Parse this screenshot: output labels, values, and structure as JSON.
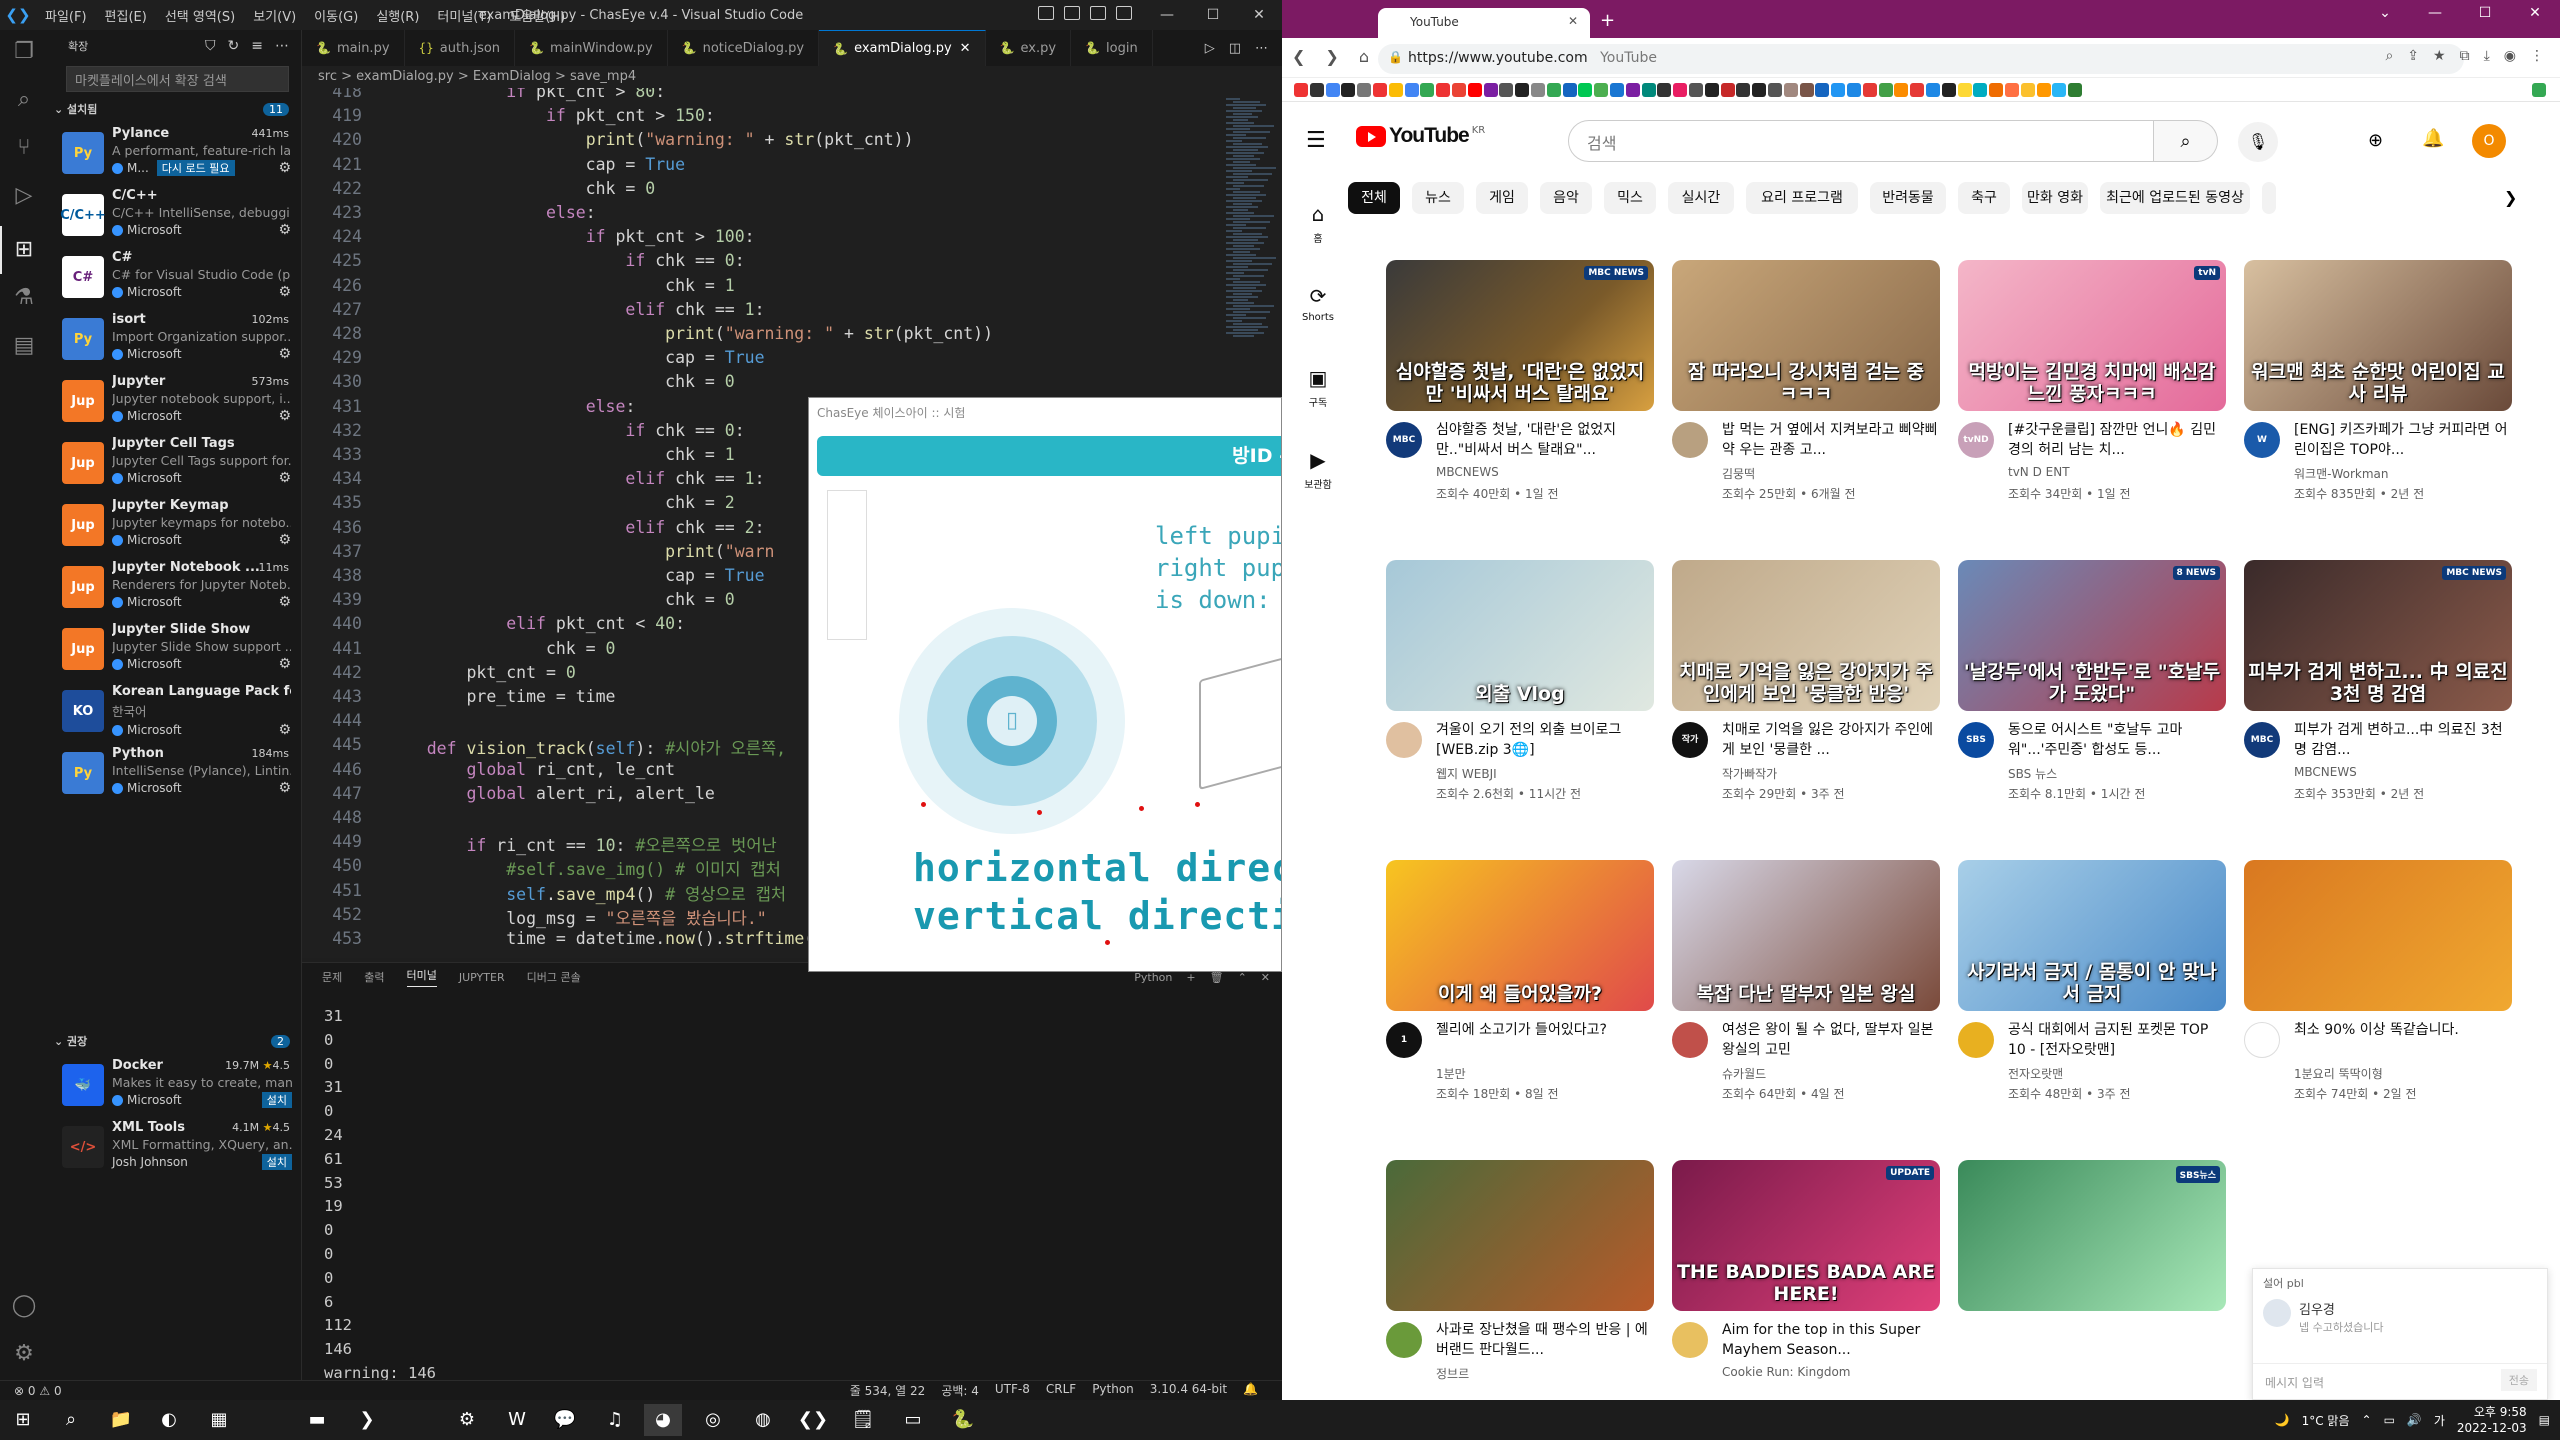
{
  "vscode": {
    "window_title": "examDialog.py - ChasEye v.4 - Visual Studio Code",
    "menu": [
      "파일(F)",
      "편집(E)",
      "선택 영역(S)",
      "보기(V)",
      "이동(G)",
      "실행(R)",
      "터미널(T)",
      "도움말(H)"
    ],
    "sidebar": {
      "header": "확장",
      "search_placeholder": "마켓플레이스에서 확장 검색",
      "installed_label": "설치됨",
      "installed_count": "11",
      "recommended_label": "권장",
      "recommended_count": "2",
      "extensions": [
        {
          "name": "Pylance",
          "time": "441ms",
          "desc": "A performant, feature-rich la...",
          "publisher": "M...",
          "badge": "다시 로드 필요"
        },
        {
          "name": "C/C++",
          "time": "",
          "desc": "C/C++ IntelliSense, debuggi...",
          "publisher": "Microsoft",
          "badge": ""
        },
        {
          "name": "C#",
          "time": "",
          "desc": "C# for Visual Studio Code (p...",
          "publisher": "Microsoft",
          "badge": ""
        },
        {
          "name": "isort",
          "time": "102ms",
          "desc": "Import Organization suppor...",
          "publisher": "Microsoft",
          "badge": ""
        },
        {
          "name": "Jupyter",
          "time": "573ms",
          "desc": "Jupyter notebook support, i...",
          "publisher": "Microsoft",
          "badge": ""
        },
        {
          "name": "Jupyter Cell Tags",
          "time": "",
          "desc": "Jupyter Cell Tags support for...",
          "publisher": "Microsoft",
          "badge": ""
        },
        {
          "name": "Jupyter Keymap",
          "time": "",
          "desc": "Jupyter keymaps for notebo...",
          "publisher": "Microsoft",
          "badge": ""
        },
        {
          "name": "Jupyter Notebook ...",
          "time": "11ms",
          "desc": "Renderers for Jupyter Noteb...",
          "publisher": "Microsoft",
          "badge": ""
        },
        {
          "name": "Jupyter Slide Show",
          "time": "",
          "desc": "Jupyter Slide Show support ...",
          "publisher": "Microsoft",
          "badge": ""
        },
        {
          "name": "Korean Language Pack for...",
          "time": "",
          "desc": "한국어",
          "publisher": "Microsoft",
          "badge": ""
        },
        {
          "name": "Python",
          "time": "184ms",
          "desc": "IntelliSense (Pylance), Lintin...",
          "publisher": "Microsoft",
          "badge": ""
        }
      ],
      "recommended": [
        {
          "name": "Docker",
          "downloads": "19.7M",
          "rating": "4.5",
          "desc": "Makes it easy to create, man...",
          "publisher": "Microsoft",
          "install": "설치"
        },
        {
          "name": "XML Tools",
          "downloads": "4.1M",
          "rating": "4.5",
          "desc": "XML Formatting, XQuery, an...",
          "publisher": "Josh Johnson",
          "install": "설치"
        }
      ]
    },
    "tabs": [
      "main.py",
      "auth.json",
      "mainWindow.py",
      "noticeDialog.py",
      "examDialog.py",
      "ex.py",
      "login"
    ],
    "breadcrumb": "src > examDialog.py > ExamDialog > save_mp4",
    "code_lines": [
      {
        "n": "418",
        "t": "            if pkt_cnt > 80:"
      },
      {
        "n": "419",
        "t": "                if pkt_cnt > 150:"
      },
      {
        "n": "420",
        "t": "                    print(\"warning: \" + str(pkt_cnt))"
      },
      {
        "n": "421",
        "t": "                    cap = True"
      },
      {
        "n": "422",
        "t": "                    chk = 0"
      },
      {
        "n": "423",
        "t": "                else:"
      },
      {
        "n": "424",
        "t": "                    if pkt_cnt > 100:"
      },
      {
        "n": "425",
        "t": "                        if chk == 0:"
      },
      {
        "n": "426",
        "t": "                            chk = 1"
      },
      {
        "n": "427",
        "t": "                        elif chk == 1:"
      },
      {
        "n": "428",
        "t": "                            print(\"warning: \" + str(pkt_cnt))"
      },
      {
        "n": "429",
        "t": "                            cap = True"
      },
      {
        "n": "430",
        "t": "                            chk = 0"
      },
      {
        "n": "431",
        "t": "                    else:"
      },
      {
        "n": "432",
        "t": "                        if chk == 0:"
      },
      {
        "n": "433",
        "t": "                            chk = 1"
      },
      {
        "n": "434",
        "t": "                        elif chk == 1:"
      },
      {
        "n": "435",
        "t": "                            chk = 2"
      },
      {
        "n": "436",
        "t": "                        elif chk == 2:"
      },
      {
        "n": "437",
        "t": "                            print(\"warn"
      },
      {
        "n": "438",
        "t": "                            cap = True"
      },
      {
        "n": "439",
        "t": "                            chk = 0"
      },
      {
        "n": "440",
        "t": "            elif pkt_cnt < 40:"
      },
      {
        "n": "441",
        "t": "                chk = 0"
      },
      {
        "n": "442",
        "t": "        pkt_cnt = 0"
      },
      {
        "n": "443",
        "t": "        pre_time = time"
      },
      {
        "n": "444",
        "t": ""
      },
      {
        "n": "445",
        "t": "    def vision_track(self): #시야가 오른쪽,"
      },
      {
        "n": "446",
        "t": "        global ri_cnt, le_cnt"
      },
      {
        "n": "447",
        "t": "        global alert_ri, alert_le"
      },
      {
        "n": "448",
        "t": ""
      },
      {
        "n": "449",
        "t": "        if ri_cnt == 10: #오른쪽으로 벗어난"
      },
      {
        "n": "450",
        "t": "            #self.save_img() # 이미지 캡처"
      },
      {
        "n": "451",
        "t": "            self.save_mp4() # 영상으로 캡처"
      },
      {
        "n": "452",
        "t": "            log_msg = \"오른쪽을 봤습니다.\""
      },
      {
        "n": "453",
        "t": "            time = datetime.now().strftime("
      }
    ],
    "panel_tabs": [
      "문제",
      "출력",
      "터미널",
      "JUPYTER",
      "디버그 콘솔"
    ],
    "panel_active": "터미널",
    "panel_shell": "Python",
    "terminal_lines": [
      "31",
      "0",
      "0",
      "31",
      "0",
      "24",
      "61",
      "53",
      "19",
      "0",
      "0",
      "0",
      "6",
      "112",
      "146",
      "warning: 146"
    ],
    "status": {
      "errors": "0",
      "warnings": "0",
      "position": "줄 534, 열 22",
      "spaces": "공백: 4",
      "encoding": "UTF-8",
      "eol": "CRLF",
      "language": "Python",
      "interpreter": "3.10.4 64-bit"
    }
  },
  "dialog": {
    "title": "ChasEye 체이스아이 :: 시험",
    "banner": "방ID -",
    "pupil_lines": [
      "left pupil:",
      "right pupi",
      "is down: "
    ],
    "direction_h": "horizontal direction",
    "direction_v": "vertical direction"
  },
  "chrome": {
    "tab_title": "YouTube",
    "url": "https://www.youtube.com",
    "url_hint": "YouTube"
  },
  "youtube": {
    "logo": "YouTube",
    "region": "KR",
    "search_placeholder": "검색",
    "avatar": "O",
    "guide": [
      {
        "label": "홈",
        "icon": "⌂"
      },
      {
        "label": "Shorts",
        "icon": "⟳"
      },
      {
        "label": "구독",
        "icon": "▣"
      },
      {
        "label": "보관함",
        "icon": "▶"
      }
    ],
    "chips": [
      "전체",
      "뉴스",
      "게임",
      "음악",
      "믹스",
      "실시간",
      "요리 프로그램",
      "반려동물",
      "축구",
      "만화 영화",
      "최근에 업로드된 동영상"
    ],
    "videos": [
      {
        "caption": "심야할증 첫날, '대란'은 없었지만 '비싸서 버스 탈래요'",
        "title": "심야할증 첫날, '대란'은 없었지만..\"비싸서 버스 탈래요\"...",
        "channel": "MBCNEWS",
        "meta": "조회수 40만회 • 1일 전",
        "tag": "MBC NEWS",
        "avatar": "MBC"
      },
      {
        "caption": "잠 따라오니 강시처럼 걷는 중 ㅋㅋㅋ",
        "title": "밥 먹는 거 옆에서 지켜보라고 삐약삐약 우는 관종 고...",
        "channel": "김뭉떡",
        "meta": "조회수 25만회 • 6개월 전",
        "tag": "",
        "avatar": ""
      },
      {
        "caption": "먹방이는 김민경 치마에 배신감 느낀 풍자ㅋㅋㅋ",
        "title": "[#갓구운클립] 잠깐만 언니🔥 김민경의 허리 남는 치...",
        "channel": "tvN D ENT",
        "meta": "조회수 34만회 • 1일 전",
        "tag": "tvN",
        "avatar": "tvND"
      },
      {
        "caption": "워크맨 최초 순한맛 어린이집 교사 리뷰",
        "title": "[ENG] 키즈카페가 그냥 커피라면 어린이집은 TOP야...",
        "channel": "워크맨-Workman",
        "meta": "조회수 835만회 • 2년 전",
        "tag": "",
        "avatar": "W"
      },
      {
        "caption": "외출 Vlog",
        "title": "겨울이 오기 전의 외출 브이로그 [WEB.zip 3🌐]",
        "channel": "웹지 WEBJI",
        "meta": "조회수 2.6천회 • 11시간 전",
        "tag": "",
        "avatar": ""
      },
      {
        "caption": "치매로 기억을 잃은 강아지가 주인에게 보인 '뭉클한 반응'",
        "title": "치매로 기억을 잃은 강아지가 주인에게 보인 '뭉클한 ...",
        "channel": "작가빠작가",
        "meta": "조회수 29만회 • 3주 전",
        "tag": "",
        "avatar": "작가"
      },
      {
        "caption": "'날강두'에서 '한반두'로 \"호날두가 도왔다\"",
        "title": "동으로 어시스트 \"호날두 고마워\"...'주민증' 합성도 등...",
        "channel": "SBS 뉴스",
        "meta": "조회수 8.1만회 • 1시간 전",
        "tag": "8 NEWS",
        "avatar": "SBS"
      },
      {
        "caption": "피부가 검게 변하고... 中 의료진 3천 명 감염",
        "title": "피부가 검게 변하고...中 의료진 3천 명 감염...",
        "channel": "MBCNEWS",
        "meta": "조회수 353만회 • 2년 전",
        "tag": "MBC NEWS",
        "avatar": "MBC"
      },
      {
        "caption": "이게 왜 들어있을까?",
        "title": "젤리에 소고기가 들어있다고?",
        "channel": "1분만",
        "meta": "조회수 18만회 • 8일 전",
        "tag": "",
        "avatar": "1"
      },
      {
        "caption": "복잡 다난 딸부자 일본 왕실",
        "title": "여성은 왕이 될 수 없다, 딸부자 일본 왕실의 고민",
        "channel": "슈카월드",
        "meta": "조회수 64만회 • 4일 전",
        "tag": "",
        "avatar": ""
      },
      {
        "caption": "사기라서 금지 / 몸통이 안 맞나서 금지",
        "title": "공식 대회에서 금지된 포켓몬 TOP 10 - [전자오랏맨]",
        "channel": "전자오랏맨",
        "meta": "조회수 48만회 • 3주 전",
        "tag": "",
        "avatar": ""
      },
      {
        "caption": "",
        "title": "최소 90% 이상 똑같습니다.",
        "channel": "1분요리 뚝딱이형",
        "meta": "조회수 74만회 • 2일 전",
        "tag": "",
        "avatar": ""
      },
      {
        "caption": "",
        "title": "사과로 장난쳤을 때 팽수의 반응 | 에버랜드 판다월드...",
        "channel": "정브르",
        "meta": "",
        "tag": "",
        "avatar": ""
      },
      {
        "caption": "THE BADDIES BADA ARE HERE!",
        "title": "Aim for the top in this Super Mayhem Season...",
        "channel": "Cookie Run: Kingdom",
        "meta": "",
        "tag": "UPDATE",
        "avatar": ""
      },
      {
        "caption": "",
        "title": "",
        "channel": "",
        "meta": "",
        "tag": "SBS뉴스",
        "avatar": ""
      }
    ]
  },
  "chat": {
    "header": "설어 pbl",
    "name": "김우경",
    "message": "넵 수고하셨습니다",
    "input_placeholder": "메시지 입력",
    "send": "전송"
  },
  "taskbar": {
    "weather": "1°C 맑음",
    "time": "오후 9:58",
    "date": "2022-12-03"
  }
}
